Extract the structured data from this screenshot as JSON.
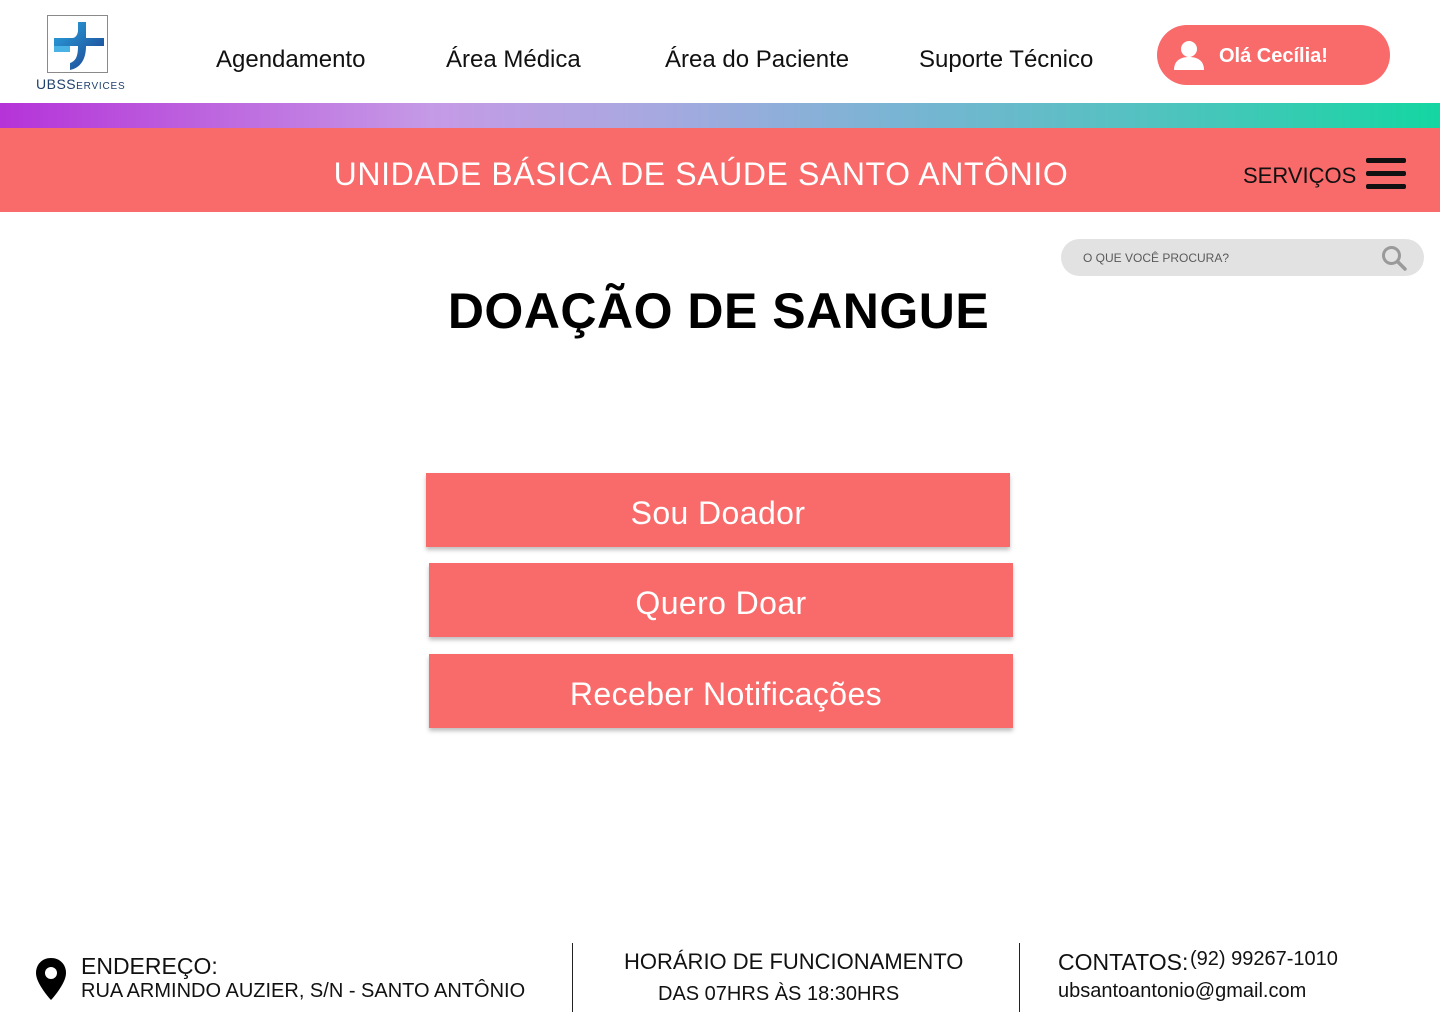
{
  "header": {
    "logo": {
      "text_main": "UBS",
      "text_small": "ERVICES",
      "text_initial": "S"
    },
    "nav": [
      {
        "label": "Agendamento"
      },
      {
        "label": "Área Médica"
      },
      {
        "label": "Área do Paciente"
      },
      {
        "label": "Suporte Técnico"
      }
    ],
    "user_button": {
      "label": "Olá Cecília!",
      "icon": "user-icon"
    }
  },
  "colors": {
    "accent": "#f96a6a",
    "gradient": [
      "#b533d8",
      "#c59ae6",
      "#7ab4d4",
      "#14d6a2"
    ],
    "search_bg": "#e2e2e2"
  },
  "banner": {
    "title": "UNIDADE BÁSICA DE SAÚDE SANTO ANTÔNIO",
    "services_label": "SERVIÇOS",
    "menu_icon": "hamburger-icon"
  },
  "search": {
    "placeholder": "O QUE VOCÊ PROCURA?",
    "value": "",
    "icon": "search-icon"
  },
  "main": {
    "title": "DOAÇÃO DE SANGUE",
    "actions": [
      {
        "label": "Sou Doador"
      },
      {
        "label": "Quero Doar"
      },
      {
        "label": "Receber Notificações"
      }
    ]
  },
  "footer": {
    "address": {
      "icon": "location-pin-icon",
      "label": "ENDEREÇO:",
      "value": "RUA ARMINDO AUZIER, S/N - SANTO ANTÔNIO"
    },
    "hours": {
      "label": "HORÁRIO DE FUNCIONAMENTO",
      "value": "DAS 07HRS ÀS 18:30HRS"
    },
    "contacts": {
      "label": "CONTATOS:",
      "phone": "(92) 99267-1010",
      "email": "ubsantoantonio@gmail.com"
    }
  }
}
